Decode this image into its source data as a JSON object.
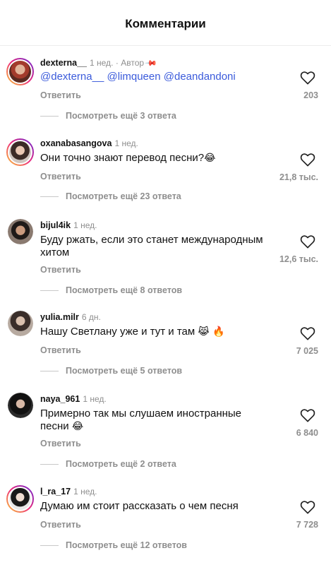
{
  "header": {
    "title": "Комментарии"
  },
  "colors": {
    "mention": "#3b5bdb",
    "muted": "#8e8e8e",
    "story_ring": "#ee2a7b"
  },
  "comments": [
    {
      "username": "dexterna__",
      "time": "1 нед.",
      "author_badge": "· Автор",
      "pinned": true,
      "text_mentions": [
        "@dexterna__",
        "@limqueen",
        "@deandandoni"
      ],
      "reply_label": "Ответить",
      "likes": "203",
      "more_replies": "Посмотреть ещё 3 ответа",
      "has_story_ring": true
    },
    {
      "username": "oxanabasangova",
      "time": "1 нед.",
      "text": "Они точно знают перевод песни?",
      "text_emoji": "😂",
      "reply_label": "Ответить",
      "likes": "21,8 тыс.",
      "more_replies": "Посмотреть ещё 23 ответа",
      "has_story_ring": true
    },
    {
      "username": "bijul4ik",
      "time": "1 нед.",
      "text": "Буду ржать, если это станет международным хитом",
      "reply_label": "Ответить",
      "likes": "12,6 тыс.",
      "more_replies": "Посмотреть ещё 8 ответов",
      "has_story_ring": false
    },
    {
      "username": "yulia.milr",
      "time": "6 дн.",
      "text": "Нашу Светлану уже и тут и там",
      "text_emoji": "😹 🔥",
      "reply_label": "Ответить",
      "likes": "7 025",
      "more_replies": "Посмотреть ещё 5 ответов",
      "has_story_ring": false
    },
    {
      "username": "naya_961",
      "time": "1 нед.",
      "text": "Примерно так мы слушаем иностранные песни",
      "text_emoji": "😂",
      "reply_label": "Ответить",
      "likes": "6 840",
      "more_replies": "Посмотреть ещё 2 ответа",
      "has_story_ring": false
    },
    {
      "username": "l_ra_17",
      "time": "1 нед.",
      "text": "Думаю им стоит рассказать о чем песня",
      "reply_label": "Ответить",
      "likes": "7 728",
      "more_replies": "Посмотреть ещё 12 ответов",
      "has_story_ring": true
    }
  ]
}
